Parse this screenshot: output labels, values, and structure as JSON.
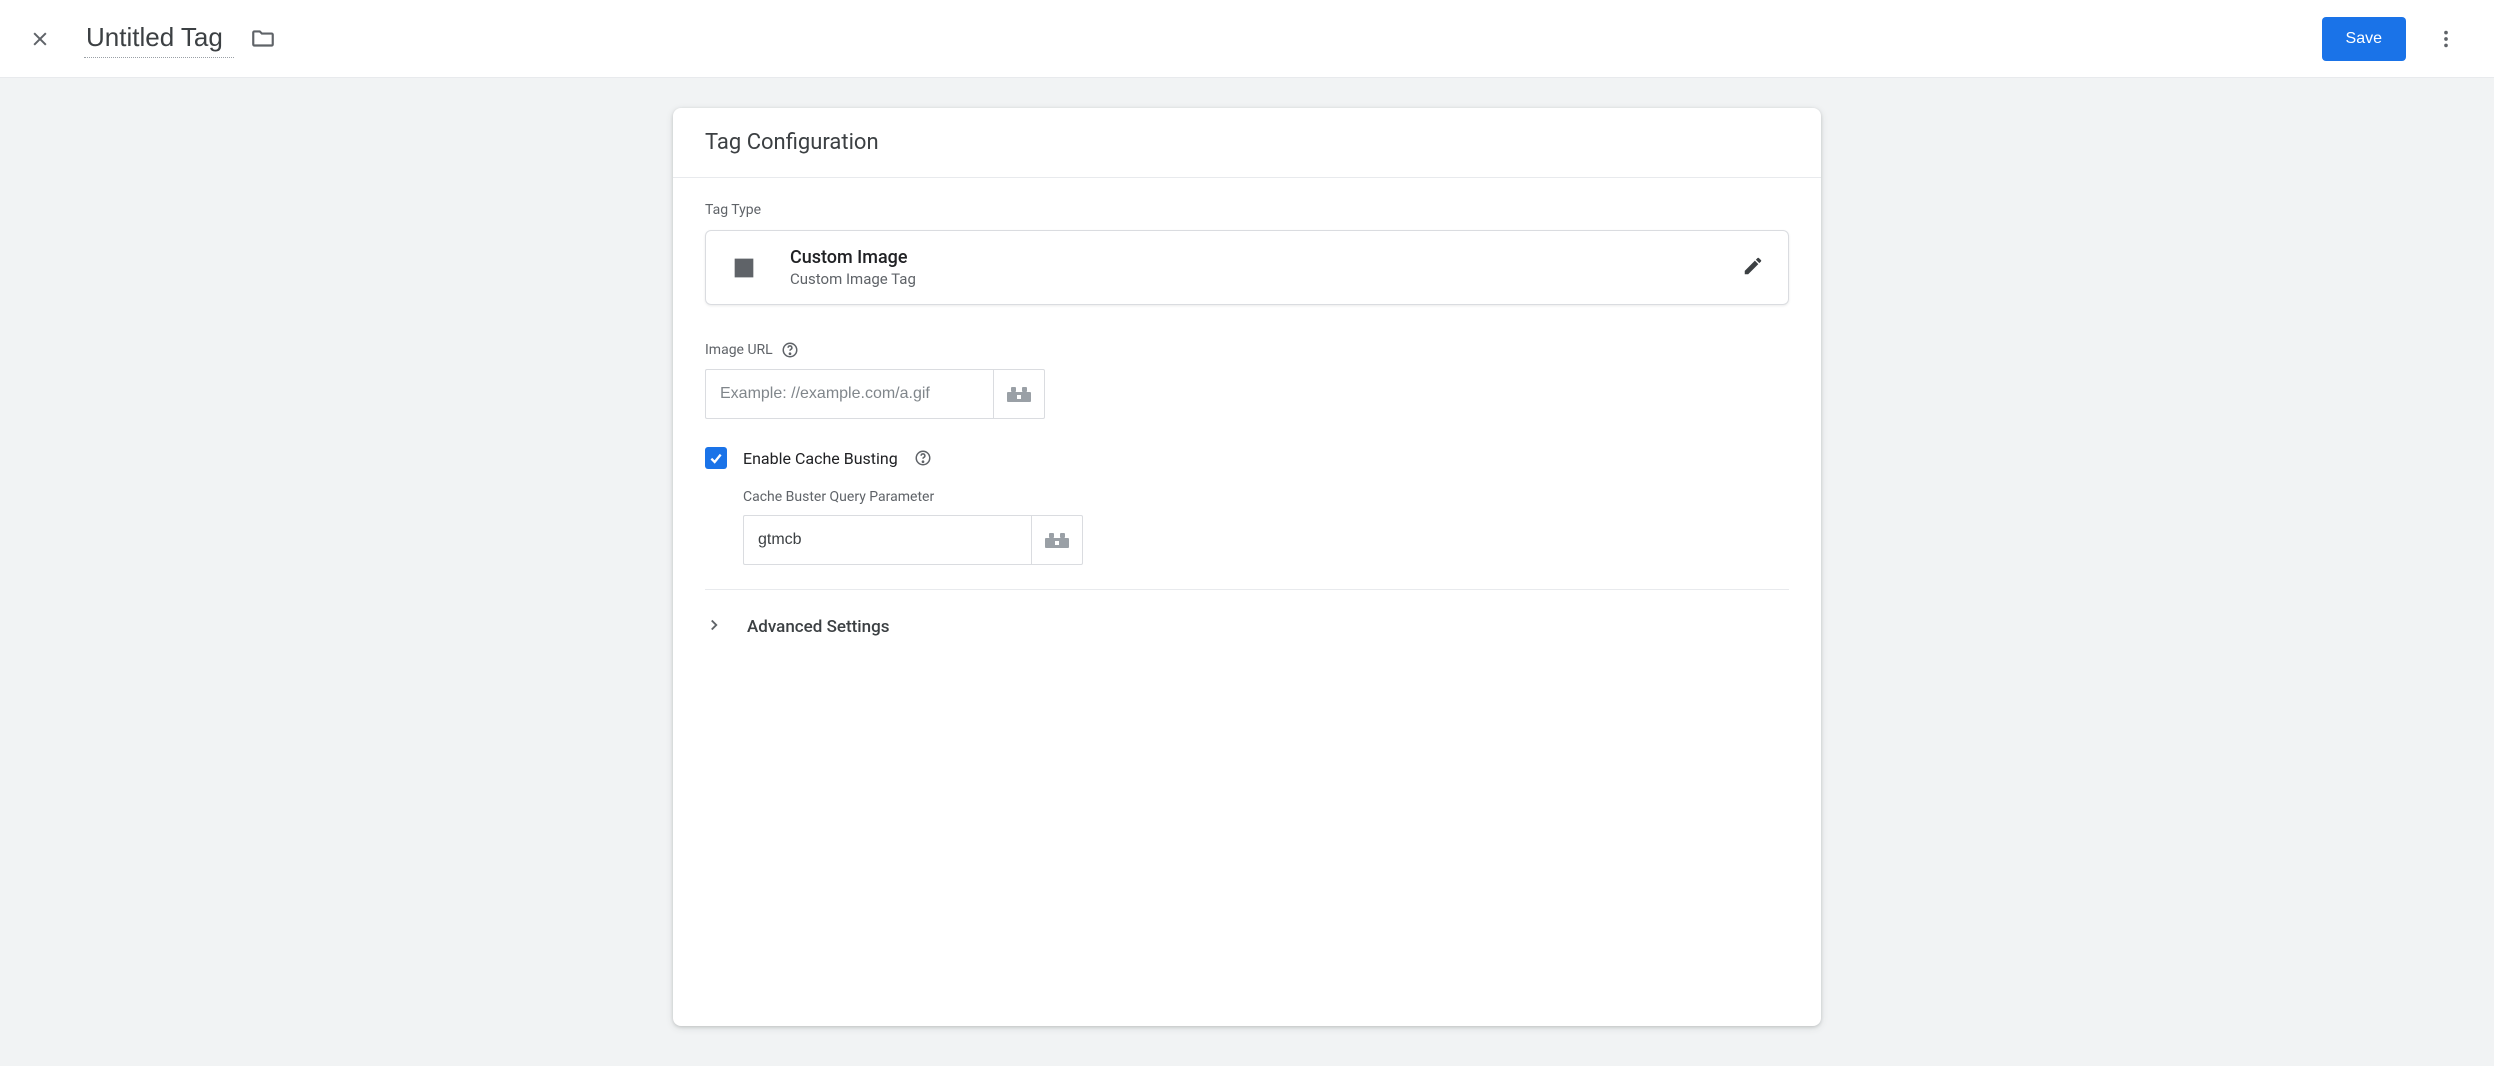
{
  "header": {
    "title": "Untitled Tag",
    "save_label": "Save"
  },
  "card": {
    "title": "Tag Configuration",
    "tag_type_label": "Tag Type",
    "tag_type": {
      "name": "Custom Image",
      "description": "Custom Image Tag"
    },
    "image_url": {
      "label": "Image URL",
      "placeholder": "Example: //example.com/a.gif",
      "value": ""
    },
    "cache_busting": {
      "checkbox_label": "Enable Cache Busting",
      "checked": true,
      "param_label": "Cache Buster Query Parameter",
      "param_value": "gtmcb"
    },
    "advanced_label": "Advanced Settings"
  }
}
